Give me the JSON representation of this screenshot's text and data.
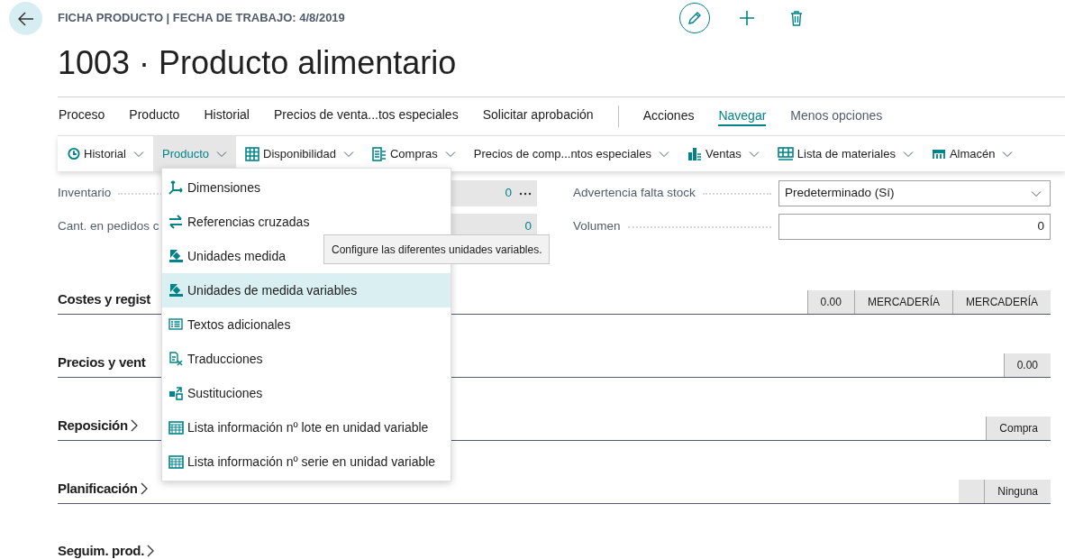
{
  "header": {
    "caption": "FICHA PRODUCTO | FECHA DE TRABAJO: 4/8/2019",
    "title": "1003 · Producto alimentario"
  },
  "tabs": [
    {
      "label": "Proceso",
      "selected": false
    },
    {
      "label": "Producto",
      "selected": false
    },
    {
      "label": "Historial",
      "selected": false
    },
    {
      "label": "Precios de venta...tos especiales",
      "selected": false
    },
    {
      "label": "Solicitar aprobación",
      "selected": false
    }
  ],
  "nav_tabs": [
    {
      "label": "Acciones",
      "selected": false
    },
    {
      "label": "Navegar",
      "selected": true
    }
  ],
  "less_options": "Menos opciones",
  "subbar": [
    {
      "label": "Historial",
      "selected": false
    },
    {
      "label": "Producto",
      "selected": true
    },
    {
      "label": "Disponibilidad",
      "selected": false
    },
    {
      "label": "Compras",
      "selected": false
    },
    {
      "label": "Precios de comp...ntos especiales",
      "selected": false
    },
    {
      "label": "Ventas",
      "selected": false
    },
    {
      "label": "Lista de materiales",
      "selected": false
    },
    {
      "label": "Almacén",
      "selected": false
    }
  ],
  "fields_left": [
    {
      "label": "Inventario",
      "value": "0",
      "ellipsis": true
    },
    {
      "label": "Cant. en pedidos c",
      "value": "0",
      "ellipsis": false
    }
  ],
  "fields_right": [
    {
      "label": "Advertencia falta stock",
      "kind": "select",
      "value": "Predeterminado (Sí)"
    },
    {
      "label": "Volumen",
      "kind": "input",
      "value": "0"
    }
  ],
  "sections": [
    {
      "title": "Costes y regist",
      "chevron": false,
      "summary": [
        {
          "kind": "value",
          "text": "0.00"
        },
        {
          "kind": "value",
          "text": "MERCADERÍA"
        },
        {
          "kind": "value",
          "text": "MERCADERÍA"
        }
      ]
    },
    {
      "title": "Precios y vent",
      "chevron": false,
      "summary": [
        {
          "kind": "value",
          "text": "0.00"
        }
      ]
    },
    {
      "title": "Reposición",
      "chevron": true,
      "summary": [
        {
          "kind": "value",
          "text": "Compra"
        }
      ]
    },
    {
      "title": "Planificación",
      "chevron": true,
      "summary": [
        {
          "kind": "blank"
        },
        {
          "kind": "value",
          "text": "Ninguna"
        }
      ]
    },
    {
      "title": "Seguim. prod.",
      "chevron": true
    }
  ],
  "menu": {
    "items": [
      {
        "label": "Dimensiones",
        "selected": false
      },
      {
        "label": "Referencias cruzadas",
        "selected": false
      },
      {
        "label": "Unidades medida",
        "selected": false
      },
      {
        "label": "Unidades de medida variables",
        "selected": true
      },
      {
        "label": "Textos adicionales",
        "selected": false
      },
      {
        "label": "Traducciones",
        "selected": false
      },
      {
        "label": "Sustituciones",
        "selected": false
      },
      {
        "label": "Lista información nº lote en unidad variable",
        "selected": false
      },
      {
        "label": "Lista información nº serie en unidad variable",
        "selected": false
      }
    ]
  },
  "tooltip": "Configure las diferentes unidades variables."
}
